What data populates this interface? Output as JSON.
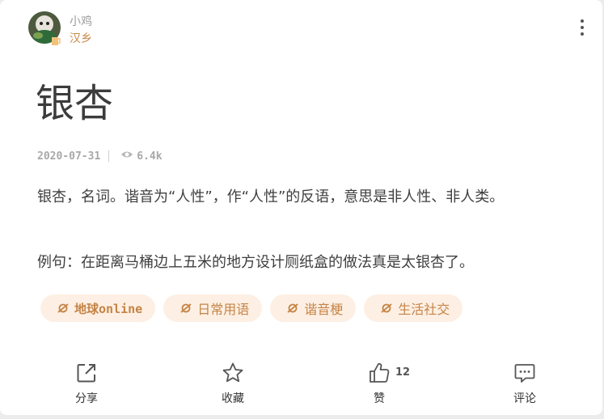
{
  "author": {
    "username": "小鸡",
    "location": "汉乡"
  },
  "entry": {
    "title": "银杏",
    "date": "2020-07-31",
    "views": "6.4k",
    "definition": "银杏，名词。谐音为“人性”，作“人性”的反语，意思是非人性、非人类。",
    "example": "例句：在距离马桶边上五米的地方设计厕纸盒的做法真是太银杏了。"
  },
  "tags": [
    {
      "label": "地球online",
      "icon": "planet-icon"
    },
    {
      "label": "日常用语",
      "icon": "planet-icon"
    },
    {
      "label": "谐音梗",
      "icon": "planet-icon"
    },
    {
      "label": "生活社交",
      "icon": "planet-icon"
    }
  ],
  "actions": {
    "share_label": "分享",
    "favorite_label": "收藏",
    "like_label": "赞",
    "like_count": "12",
    "comment_label": "评论"
  },
  "colors": {
    "accent": "#c58446",
    "tag_background": "#fdefe3",
    "location": "#c78a4b"
  }
}
